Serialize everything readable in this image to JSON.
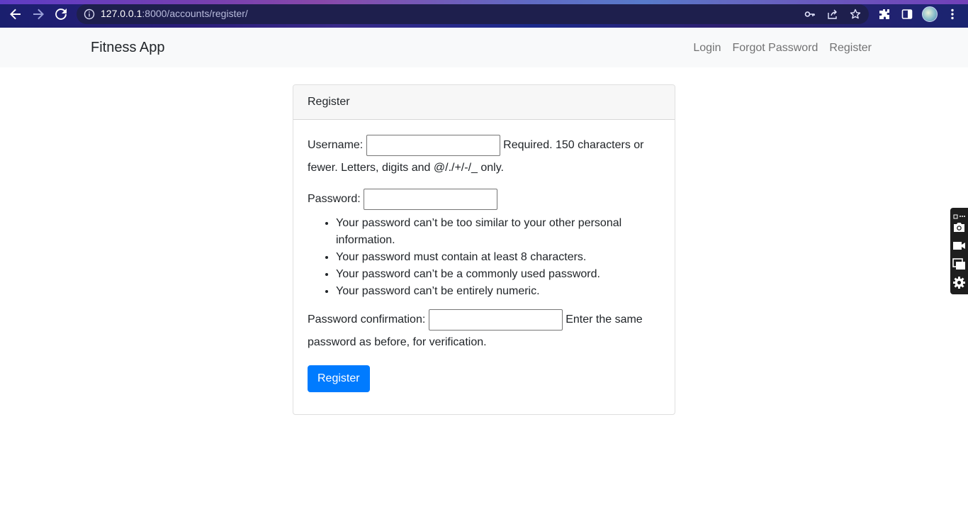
{
  "browser": {
    "url_host": "127.0.0.1",
    "url_rest": ":8000/accounts/register/",
    "icons": [
      "back-arrow-icon",
      "forward-arrow-icon",
      "reload-icon",
      "info-icon",
      "key-icon",
      "share-icon",
      "star-icon",
      "extensions-icon",
      "sidepanel-icon",
      "avatar",
      "menu-icon"
    ]
  },
  "navbar": {
    "brand": "Fitness App",
    "links": [
      "Login",
      "Forgot Password",
      "Register"
    ]
  },
  "card": {
    "header": "Register",
    "username_label": "Username:",
    "username_help": "Required. 150 characters or fewer. Letters, digits and @/./+/-/_ only.",
    "password_label": "Password:",
    "password_help": [
      "Your password can’t be too similar to your other personal information.",
      "Your password must contain at least 8 characters.",
      "Your password can’t be a commonly used password.",
      "Your password can’t be entirely numeric."
    ],
    "confirm_label": "Password confirmation:",
    "confirm_help": "Enter the same password as before, for verification.",
    "submit_label": "Register"
  },
  "colors": {
    "primary": "#007bff",
    "navbar_bg": "#f8f9fa",
    "card_header_bg": "#f7f7f7"
  }
}
